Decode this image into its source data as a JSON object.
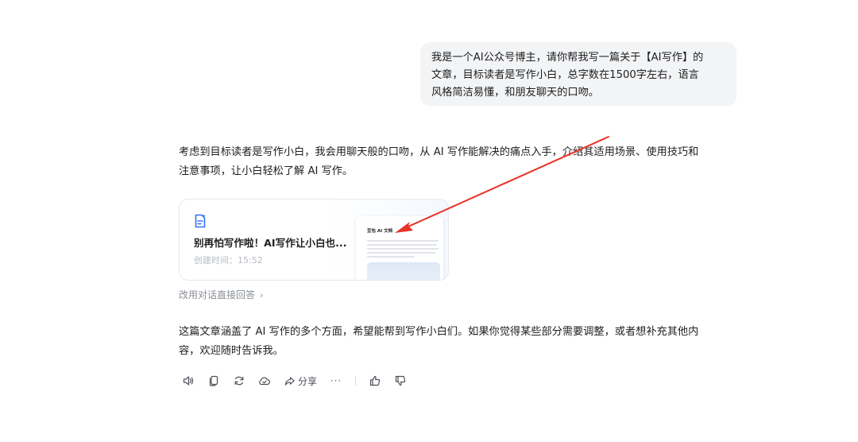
{
  "user_message": {
    "lines": [
      "我是一个AI公众号博主，请你帮我写一篇关于【AI写作】的",
      "文章，目标读者是写作小白，总字数在1500字左右，语言",
      "风格简洁易懂，和朋友聊天的口吻。"
    ]
  },
  "assistant": {
    "intro_lines": [
      "考虑到目标读者是写作小白，我会用聊天般的口吻，从 AI 写作能解决的痛点入手，介绍其适用场景、使用技巧和",
      "注意事项，让小白轻松了解 AI 写作。"
    ],
    "doc_card": {
      "title": "别再怕写作啦！AI写作让小白也...",
      "created": "创建时间：15:52",
      "preview_title": "豆包 AI 文档"
    },
    "switch_link": "改用对话直接回答",
    "outro_lines": [
      "这篇文章涵盖了 AI 写作的多个方面，希望能帮到写作小白们。如果你觉得某些部分需要调整，或者想补充其他内",
      "容，欢迎随时告诉我。"
    ],
    "actions": {
      "share_label": "分享",
      "more_label": "···"
    }
  },
  "icons": {
    "doc": "document-icon",
    "speaker": "speaker-icon",
    "copy": "copy-icon",
    "regenerate": "refresh-icon",
    "cloud": "cloud-save-icon",
    "share": "share-icon",
    "more": "more-icon",
    "like": "thumbs-up-icon",
    "dislike": "thumbs-down-icon",
    "chevron": "chevron-right-icon"
  },
  "colors": {
    "accent_blue": "#3370ff",
    "annotation_arrow": "#e8332a",
    "bubble_bg": "#f3f4f6",
    "muted_text": "#8a8f98"
  }
}
